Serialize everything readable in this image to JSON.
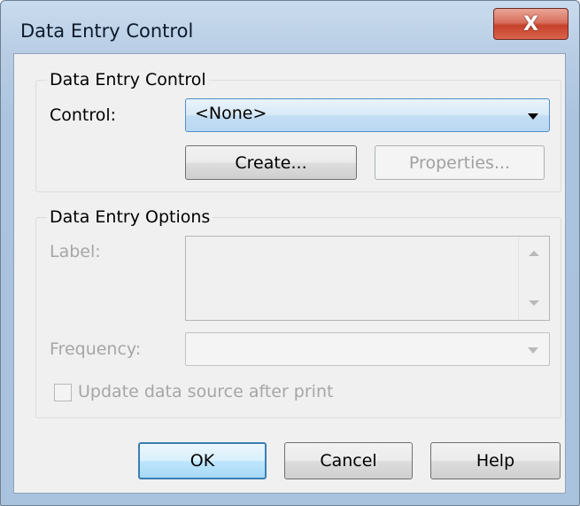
{
  "window": {
    "title": "Data Entry Control",
    "close_label": "X"
  },
  "data_entry_control_group": {
    "title": "Data Entry Control",
    "control_label": "Control:",
    "control_value": "<None>",
    "create_label": "Create...",
    "properties_label": "Properties..."
  },
  "data_entry_options_group": {
    "title": "Data Entry Options",
    "label_label": "Label:",
    "frequency_label": "Frequency:",
    "frequency_value": "",
    "update_checkbox_label": "Update data source after print",
    "update_checked": false
  },
  "footer": {
    "ok_label": "OK",
    "cancel_label": "Cancel",
    "help_label": "Help"
  }
}
